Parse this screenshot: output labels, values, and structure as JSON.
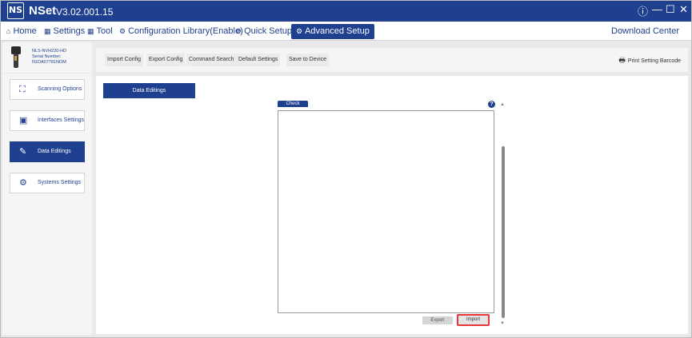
{
  "window": {
    "logo_text": "NS",
    "app_name": "NSet",
    "version": "V3.02.001.15",
    "controls": {
      "info": "ⓘ",
      "minimize": "—",
      "maximize": "☐",
      "close": "✕"
    }
  },
  "menu": {
    "items": [
      {
        "label": "Home",
        "icon": "home-icon"
      },
      {
        "label": "Settings",
        "icon": "grid-icon"
      },
      {
        "label": "Tool",
        "icon": "grid-icon"
      },
      {
        "label": "Configuration Library(Enable)",
        "icon": "gear-icon"
      },
      {
        "label": "Quick Setup",
        "icon": "gear-icon"
      },
      {
        "label": "Advanced Setup",
        "icon": "gear-wrench-icon",
        "active": true
      }
    ],
    "download_center": "Download Center"
  },
  "device": {
    "model": "NLS-NVH220-HD",
    "serial_label": "Serial Number:",
    "serial_value": "N1DA07781NOM"
  },
  "toolbar": {
    "import_config": "Import Config",
    "export_config": "Export Config",
    "command_search": "Command Search",
    "default_settings": "Default Settings",
    "save_to_device": "Save to Device",
    "print_setting_barcode": "Print Setting Barcode"
  },
  "sidebar": {
    "items": [
      {
        "label": "Scanning Options",
        "icon": "scan-frame-icon"
      },
      {
        "label": "Interfaces Settings",
        "icon": "interface-icon"
      },
      {
        "label": "Data Editings",
        "icon": "edit-icon",
        "active": true
      },
      {
        "label": "Systems Settings",
        "icon": "system-icon"
      }
    ]
  },
  "content": {
    "tab_label": "Data Editings",
    "check_label": "Check",
    "help_symbol": "?",
    "export_label": "Export",
    "import_label": "Import"
  },
  "colors": {
    "brand": "#1f3f8f",
    "highlight": "#e53935"
  }
}
